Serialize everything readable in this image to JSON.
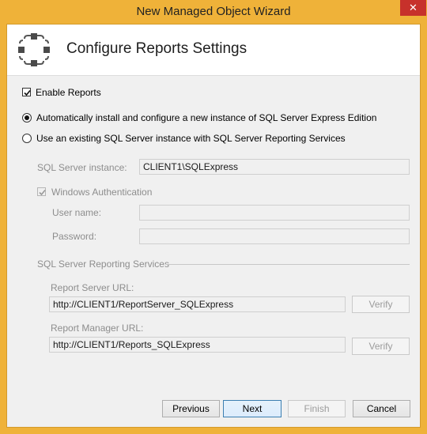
{
  "window": {
    "title": "New Managed Object Wizard",
    "close_glyph": "✕"
  },
  "header": {
    "title": "Configure Reports Settings",
    "icon": "network-nodes-icon"
  },
  "enable_reports": {
    "label": "Enable Reports",
    "checked": true
  },
  "options": {
    "auto_install": {
      "label": "Automatically install and configure a new instance of SQL Server Express Edition",
      "selected": true
    },
    "use_existing": {
      "label": "Use an existing SQL Server instance with SQL Server Reporting Services",
      "selected": false
    }
  },
  "sql": {
    "instance_label": "SQL Server instance:",
    "instance_value": "CLIENT1\\SQLExpress",
    "windows_auth_label": "Windows Authentication",
    "windows_auth_checked": true,
    "username_label": "User name:",
    "username_value": "",
    "password_label": "Password:",
    "password_value": ""
  },
  "ssrs": {
    "group_label": "SQL Server Reporting Services",
    "report_server_label": "Report Server URL:",
    "report_server_value": "http://CLIENT1/ReportServer_SQLExpress",
    "report_manager_label": "Report Manager URL:",
    "report_manager_value": "http://CLIENT1/Reports_SQLExpress",
    "verify_label": "Verify"
  },
  "footer": {
    "previous": "Previous",
    "next": "Next",
    "finish": "Finish",
    "cancel": "Cancel"
  }
}
